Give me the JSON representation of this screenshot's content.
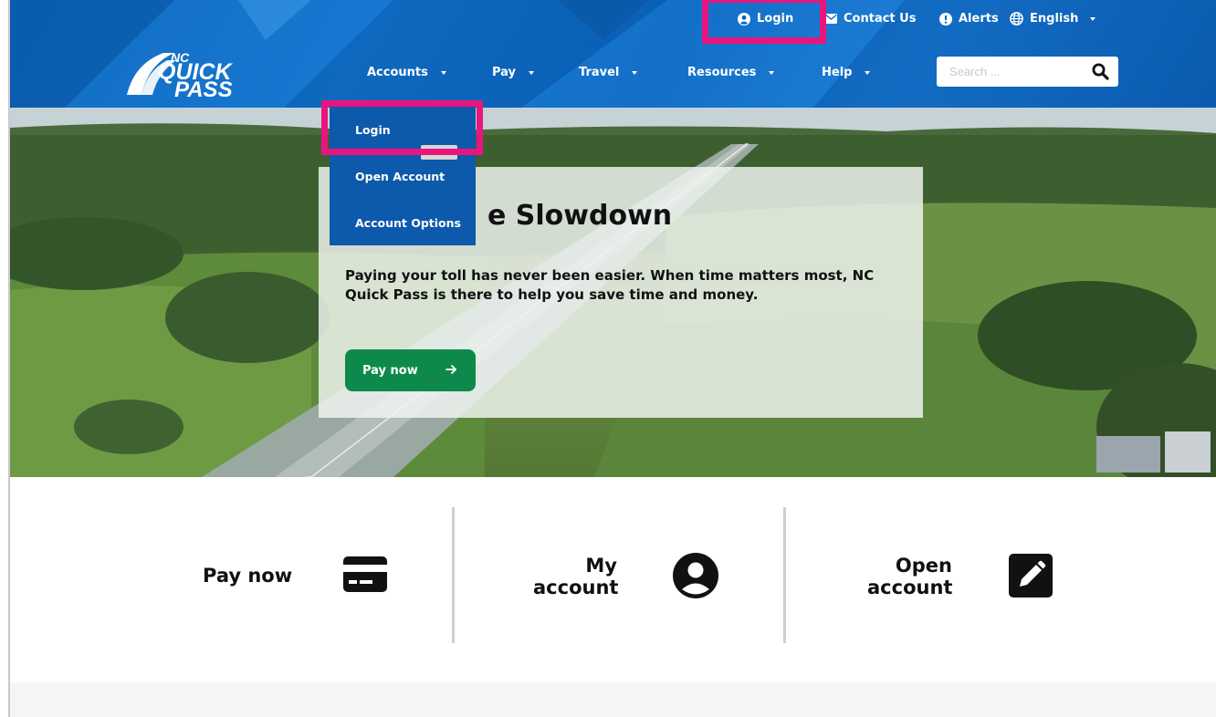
{
  "utility": {
    "login": "Login",
    "contact": "Contact Us",
    "alerts": "Alerts",
    "language": "English"
  },
  "logo": {
    "line1": "NC",
    "line2": "QUICK",
    "line3": "PASS"
  },
  "nav": {
    "items": [
      {
        "label": "Accounts"
      },
      {
        "label": "Pay"
      },
      {
        "label": "Travel"
      },
      {
        "label": "Resources"
      },
      {
        "label": "Help"
      }
    ]
  },
  "search": {
    "placeholder": "Search ..."
  },
  "dropdown": {
    "items": [
      {
        "label": "Login"
      },
      {
        "label": "Open Account"
      },
      {
        "label": "Account Options"
      }
    ]
  },
  "hero": {
    "title_fragment": "e Slowdown",
    "body": "Paying your toll has never been easier. When time matters most, NC Quick Pass is there to help you save time and money.",
    "button": "Pay now"
  },
  "quick_actions": {
    "pay_now": "Pay now",
    "my_account_1": "My",
    "my_account_2": "account",
    "open_account_1": "Open",
    "open_account_2": "account"
  },
  "colors": {
    "header_blue": "#0a64bd",
    "dropdown_blue": "#0d59ab",
    "cta_green": "#0d8a4b",
    "highlight_pink": "#e8157f"
  }
}
